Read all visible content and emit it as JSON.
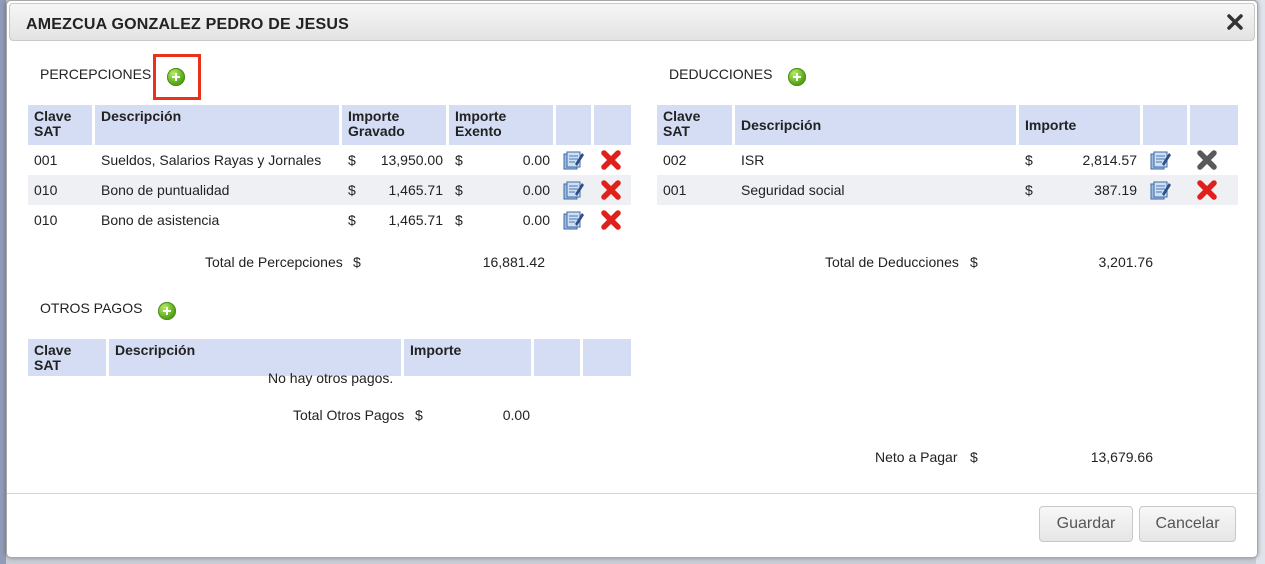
{
  "dialog": {
    "title": "AMEZCUA GONZALEZ PEDRO DE JESUS"
  },
  "percepciones": {
    "label": "PERCEPCIONES",
    "headers": {
      "clave": "Clave SAT",
      "descripcion": "Descripción",
      "gravado": "Importe Gravado",
      "exento": "Importe Exento"
    },
    "rows": [
      {
        "clave": "001",
        "descripcion": "Sueldos, Salarios Rayas y Jornales",
        "gravado": "13,950.00",
        "exento": "0.00"
      },
      {
        "clave": "010",
        "descripcion": "Bono de puntualidad",
        "gravado": "1,465.71",
        "exento": "0.00"
      },
      {
        "clave": "010",
        "descripcion": "Bono de asistencia",
        "gravado": "1,465.71",
        "exento": "0.00"
      }
    ],
    "currency": "$",
    "total_label": "Total de Percepciones",
    "total_value": "16,881.42"
  },
  "deducciones": {
    "label": "DEDUCCIONES",
    "headers": {
      "clave": "Clave SAT",
      "descripcion": "Descripción",
      "importe": "Importe"
    },
    "rows": [
      {
        "clave": "002",
        "descripcion": "ISR",
        "importe": "2,814.57",
        "delete_enabled": false
      },
      {
        "clave": "001",
        "descripcion": "Seguridad social",
        "importe": "387.19",
        "delete_enabled": true
      }
    ],
    "currency": "$",
    "total_label": "Total de Deducciones",
    "total_value": "3,201.76"
  },
  "otros_pagos": {
    "label": "OTROS PAGOS",
    "headers": {
      "clave": "Clave SAT",
      "descripcion": "Descripción",
      "importe": "Importe"
    },
    "empty_message": "No hay otros pagos.",
    "currency": "$",
    "total_label": "Total Otros Pagos",
    "total_value": "0.00"
  },
  "neto": {
    "label": "Neto a Pagar",
    "currency": "$",
    "value": "13,679.66"
  },
  "buttons": {
    "save": "Guardar",
    "cancel": "Cancelar"
  },
  "colors": {
    "header_bg": "#d5ddf5",
    "delete_red": "#e0201a",
    "add_green": "#5aa919"
  },
  "icons": {
    "add": "plus-circle-icon",
    "edit": "edit-document-icon",
    "delete": "delete-x-icon",
    "close": "close-icon"
  }
}
